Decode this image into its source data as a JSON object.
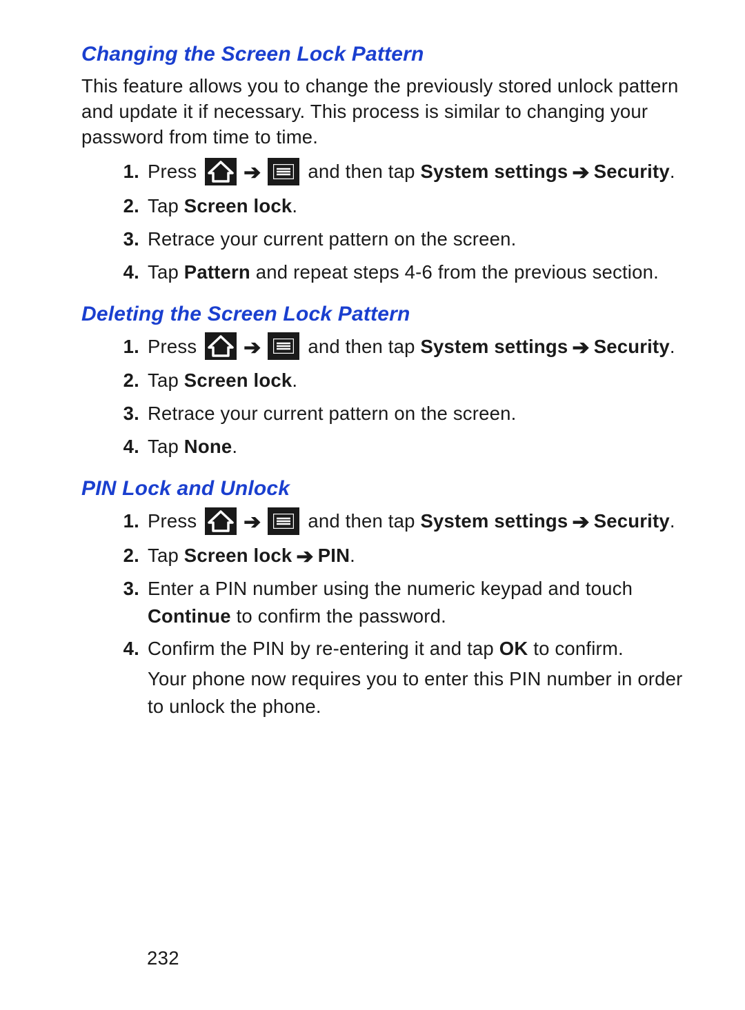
{
  "page_number": "232",
  "glyphs": {
    "arrow": "➔"
  },
  "sections": [
    {
      "id": "changing",
      "heading": "Changing the Screen Lock Pattern",
      "intro": "This feature allows you to change the previously stored unlock pattern and update it if necessary. This process is similar to changing your password from time to time.",
      "steps": {
        "s1": {
          "press": "Press ",
          "mid": " and then tap ",
          "bold1": "System settings",
          "bold2": "Security",
          "period": "."
        },
        "s2": {
          "pre": "Tap ",
          "bold": "Screen lock",
          "post": "."
        },
        "s3": {
          "text": "Retrace your current pattern on the screen."
        },
        "s4": {
          "pre": "Tap ",
          "bold": "Pattern",
          "post": " and repeat steps 4-6 from the previous section."
        }
      }
    },
    {
      "id": "deleting",
      "heading": "Deleting the Screen Lock Pattern",
      "steps": {
        "s1": {
          "press": "Press ",
          "mid": " and then tap ",
          "bold1": "System settings",
          "bold2": "Security",
          "period": "."
        },
        "s2": {
          "pre": "Tap ",
          "bold": "Screen lock",
          "post": "."
        },
        "s3": {
          "text": "Retrace your current pattern on the screen."
        },
        "s4": {
          "pre": "Tap ",
          "bold": "None",
          "post": "."
        }
      }
    },
    {
      "id": "pin",
      "heading": "PIN Lock and Unlock",
      "steps": {
        "s1": {
          "press": "Press ",
          "mid": " and then tap ",
          "bold1": "System settings",
          "bold2": "Security",
          "period": "."
        },
        "s2": {
          "pre": "Tap ",
          "bold1": "Screen lock",
          "bold2": "PIN",
          "post": "."
        },
        "s3": {
          "pre": "Enter a PIN number using the numeric keypad and touch ",
          "bold": "Continue",
          "post": " to confirm the password."
        },
        "s4": {
          "pre": "Confirm the PIN by re-entering it and tap ",
          "bold": "OK",
          "post": " to confirm.",
          "tail": "Your phone now requires you to enter this PIN number in order to unlock the phone."
        }
      }
    }
  ]
}
